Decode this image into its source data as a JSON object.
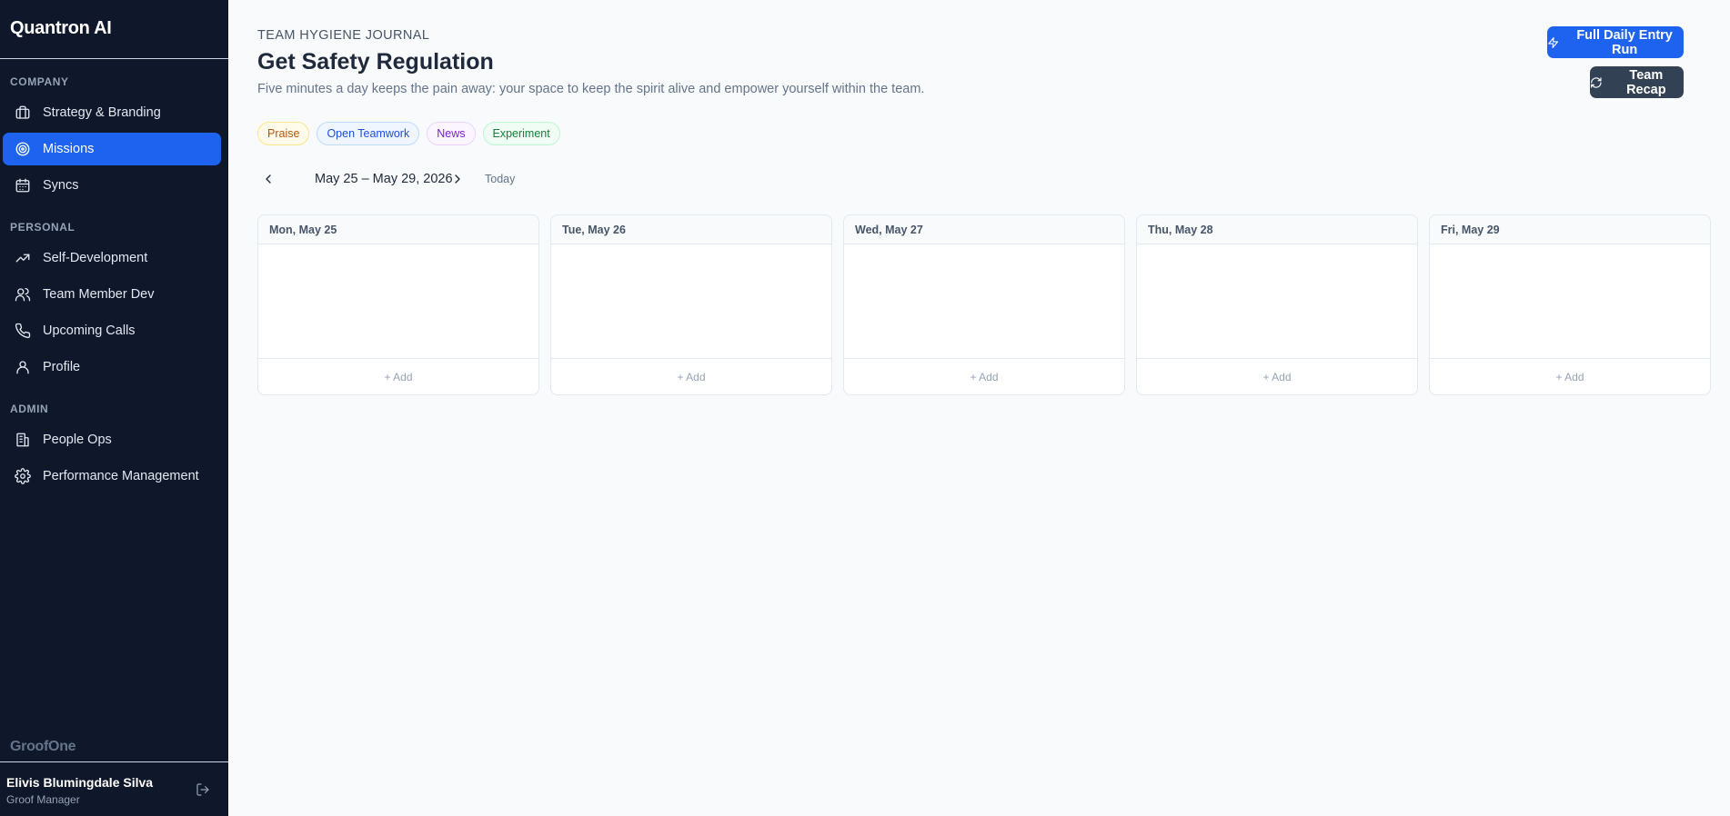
{
  "app": {
    "name": "Quantron AI",
    "footer_brand": "GroofOne"
  },
  "sidebar": {
    "sections": [
      {
        "label": "COMPANY"
      },
      {
        "label": "PERSONAL"
      },
      {
        "label": "ADMIN"
      }
    ],
    "items": [
      {
        "label": "Strategy & Branding",
        "icon": "briefcase-icon"
      },
      {
        "label": "Missions",
        "icon": "target-icon",
        "active": true
      },
      {
        "label": "Syncs",
        "icon": "calendar-icon"
      },
      {
        "label": "Self-Development",
        "icon": "trending-up-icon"
      },
      {
        "label": "Team Member Dev",
        "icon": "users-icon"
      },
      {
        "label": "Upcoming Calls",
        "icon": "phone-icon"
      },
      {
        "label": "Profile",
        "icon": "user-icon"
      },
      {
        "label": "People Ops",
        "icon": "building-icon"
      },
      {
        "label": "Performance Management",
        "icon": "gear-icon"
      }
    ]
  },
  "user": {
    "name": "Elivis Blumingdale Silva",
    "role": "Groof Manager"
  },
  "header": {
    "eyebrow": "TEAM HYGIENE JOURNAL",
    "title": "Get Safety Regulation",
    "subtitle": "Five minutes a day keeps the pain away: your space to keep the spirit alive and empower yourself within the team."
  },
  "actions": {
    "primary_label": "Full Daily Entry Run",
    "secondary_label": "Team Recap"
  },
  "tags": [
    {
      "label": "Praise",
      "color": "#b45309"
    },
    {
      "label": "Open Teamwork",
      "color": "#1d4ed8"
    },
    {
      "label": "News",
      "color": "#7e22ce"
    },
    {
      "label": "Experiment",
      "color": "#15803d"
    }
  ],
  "week": {
    "range": "May 25 – May 29, 2026",
    "today_label": "Today"
  },
  "days": [
    {
      "label": "Mon, May 25",
      "add_label": "+ Add"
    },
    {
      "label": "Tue, May 26",
      "add_label": "+ Add"
    },
    {
      "label": "Wed, May 27",
      "add_label": "+ Add"
    },
    {
      "label": "Thu, May 28",
      "add_label": "+ Add"
    },
    {
      "label": "Fri, May 29",
      "add_label": "+ Add"
    }
  ],
  "colors": {
    "accent": "#1d63f0",
    "sidebar_bg": "#0f172a",
    "dark_button": "#334155"
  }
}
